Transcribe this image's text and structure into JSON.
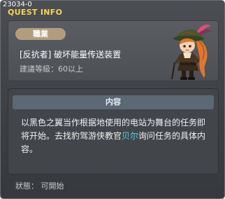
{
  "window": {
    "quest_id": "23034-0",
    "title": "QUEST INFO"
  },
  "header": {
    "job_badge": "職業",
    "quest_name": "[反抗者] 破坏能量传送装置",
    "required_level": "建議等級：60以上"
  },
  "content": {
    "heading": "内容",
    "text_before": "以黑色之翼当作根据地使用的电站为舞台的任务即将开始。去找豹驾游侠教官",
    "npc_name": "贝尔",
    "text_after": "询问任务的具体内容。"
  },
  "status": "狀態： 可開始",
  "colors": {
    "title": "#ffd44a",
    "badge": "#b19d7c",
    "npc_link": "#4fd6e8",
    "content_header": "#5b6975"
  },
  "icons": [
    "npc-portrait"
  ]
}
